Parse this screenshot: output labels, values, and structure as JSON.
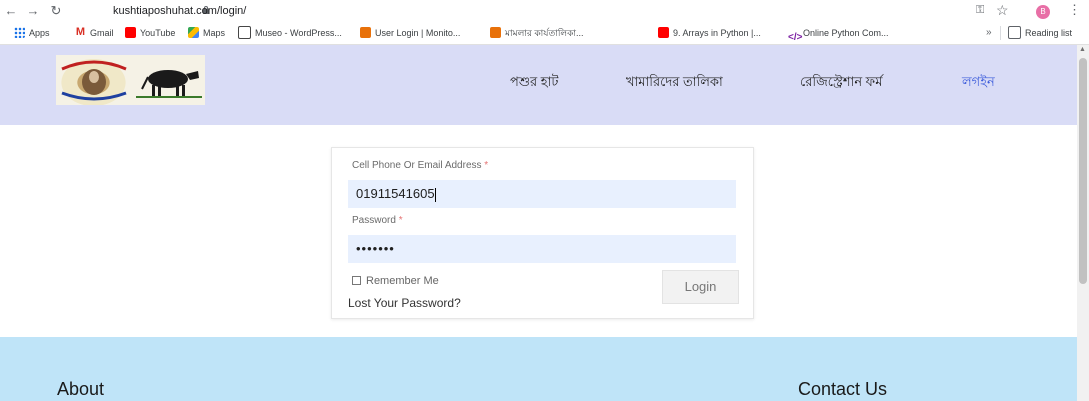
{
  "browser": {
    "url": "kushtiaposhuhat.com/login/",
    "avatar_letter": "B",
    "bookmarks": [
      {
        "label": "Apps",
        "icon": "apps-grid-icon"
      },
      {
        "label": "Gmail",
        "icon": "gmail-icon"
      },
      {
        "label": "YouTube",
        "icon": "youtube-icon"
      },
      {
        "label": "Maps",
        "icon": "maps-icon"
      },
      {
        "label": "Museo - WordPress...",
        "icon": "wordpress-icon"
      },
      {
        "label": "User Login | Monito...",
        "icon": "bookmark-icon"
      },
      {
        "label": "মামলার কার্যতালিকা...",
        "icon": "bookmark-icon"
      },
      {
        "label": "9. Arrays in Python |...",
        "icon": "youtube-icon"
      },
      {
        "label": "Online Python Com...",
        "icon": "code-icon"
      }
    ],
    "overflow_chevron": "»",
    "reading_list": "Reading list"
  },
  "header": {
    "nav": [
      {
        "label": "পশুর হাট"
      },
      {
        "label": "খামারিদের তালিকা"
      },
      {
        "label": "রেজিস্ট্রেশান ফর্ম"
      },
      {
        "label": "লগইন",
        "active": true
      }
    ],
    "bg_color": "#d9dcf6",
    "active_color": "#3b5bdb"
  },
  "login": {
    "username_label": "Cell Phone Or Email Address",
    "username_value": "01911541605",
    "password_label": "Password",
    "password_value": "•••••••",
    "required_mark": "*",
    "remember_label": "Remember Me",
    "submit_label": "Login",
    "lost_password": "Lost Your Password?"
  },
  "footer": {
    "about_title": "About",
    "contact_title": "Contact Us",
    "bg_color": "#bfe4f8"
  }
}
